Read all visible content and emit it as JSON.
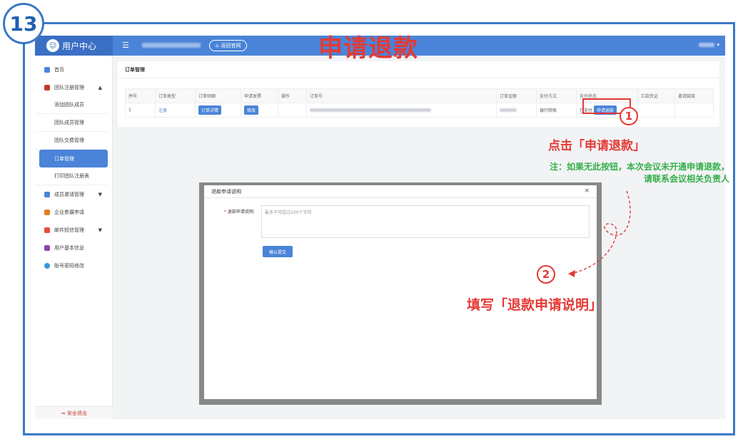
{
  "step_number": "13",
  "headline": "申请退款",
  "app": {
    "brand": "用户中心",
    "back_button": "返回官网"
  },
  "sidebar": {
    "items": [
      {
        "label": "首页"
      },
      {
        "label": "团队注册管理"
      },
      {
        "label": "添加团队成员"
      },
      {
        "label": "团队成员管理"
      },
      {
        "label": "团队交费管理"
      },
      {
        "label": "订单管理"
      },
      {
        "label": "打印团队注册表"
      },
      {
        "label": "成员邀请管理"
      },
      {
        "label": "企业参展申请"
      },
      {
        "label": "邮件短信管理"
      },
      {
        "label": "用户基本信息"
      },
      {
        "label": "账号密码修改"
      }
    ],
    "logout": "安全退出"
  },
  "orders": {
    "title": "订单管理",
    "columns": [
      "序号",
      "订单类型",
      "订单明细",
      "申请发票",
      "操作",
      "订单号",
      "订单金额",
      "支付方式",
      "支付状态",
      "汇款凭证",
      "邀请链接"
    ],
    "row": {
      "index": "1",
      "type": "注册",
      "detail_button": "订单详情",
      "invoice_button": "修改",
      "payment_method": "银行转账",
      "pay_status": "已支付",
      "refund_button": "申请退款"
    }
  },
  "modal": {
    "title": "退款申请说明",
    "label": "退款申请说明:",
    "required_mark": "*",
    "placeholder": "最多不可超过200个字符",
    "submit": "确认提交",
    "close": "×"
  },
  "annotations": {
    "step1_number": "1",
    "step1_text": "点击「申请退款」",
    "note_line1": "注：如果无此按钮，本次会议未开通申请退款，",
    "note_line2": "请联系会议相关负责人",
    "step2_number": "2",
    "step2_text": "填写「退款申请说明」"
  }
}
